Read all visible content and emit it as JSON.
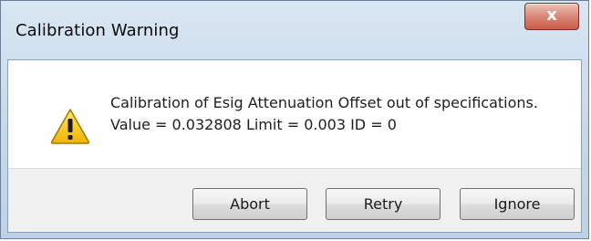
{
  "window": {
    "title": "Calibration Warning",
    "close_label": "x"
  },
  "message": {
    "line1": "Calibration of Esig Attenuation Offset out of specifications.",
    "line2": "Value = 0.032808  Limit = 0.003  ID = 0",
    "icon": "warning-icon"
  },
  "buttons": {
    "abort": "Abort",
    "retry": "Retry",
    "ignore": "Ignore"
  },
  "colors": {
    "titlebar": "#c7d8ea",
    "close_button": "#c95b45",
    "warning_icon": "#f2c200",
    "button_area": "#f0f0f0"
  }
}
